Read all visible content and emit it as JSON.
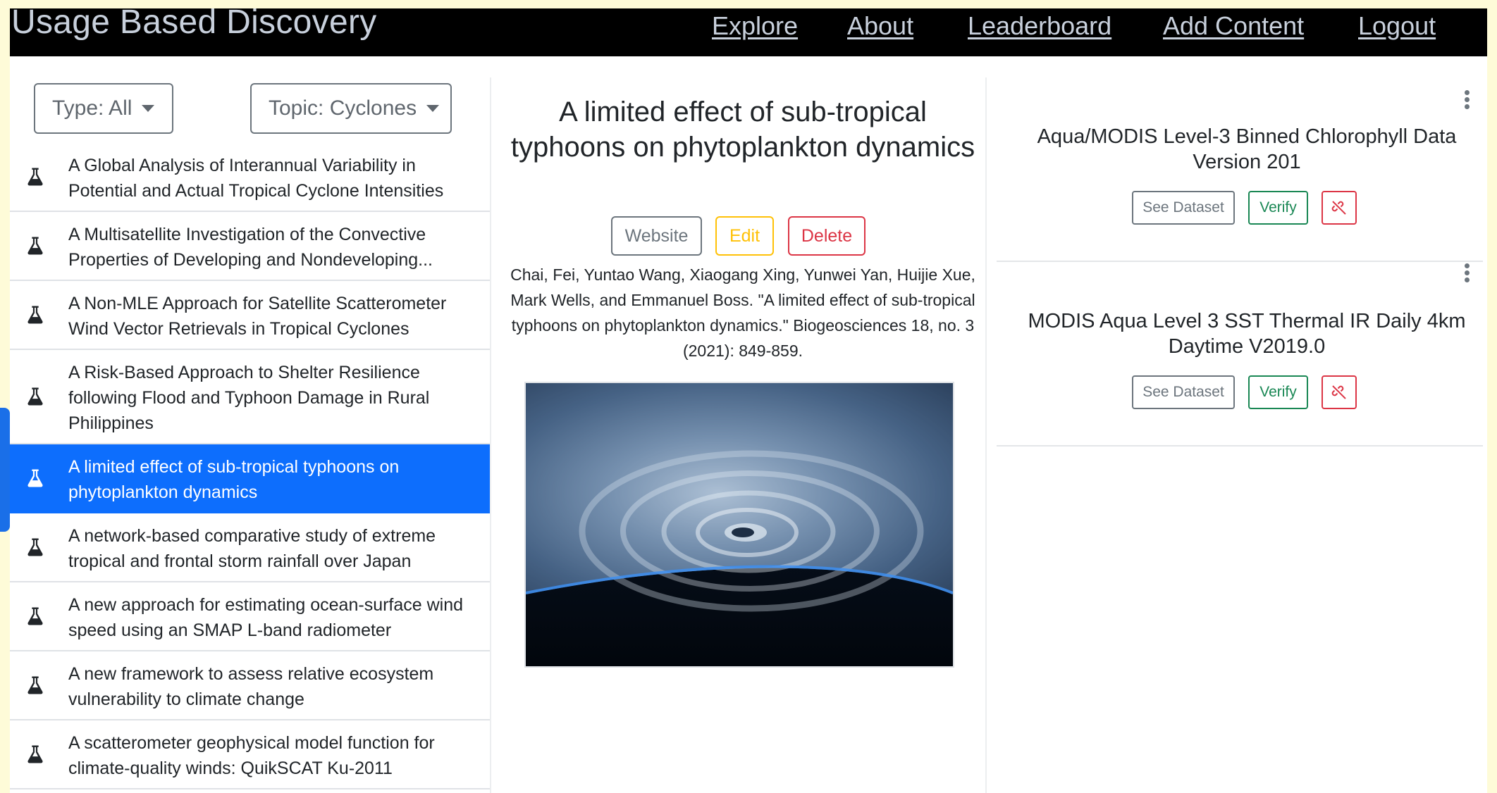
{
  "app": {
    "brand": "Usage Based Discovery"
  },
  "nav": {
    "explore": "Explore",
    "about": "About",
    "leaderboard": "Leaderboard",
    "add_content": "Add Content",
    "logout": "Logout"
  },
  "filters": {
    "type": "Type: All",
    "topic": "Topic: Cyclones"
  },
  "list": {
    "items": [
      {
        "label": "A Global Analysis of Interannual Variability in Potential and Actual Tropical Cyclone Intensities",
        "icon": "flask-icon"
      },
      {
        "label": "A Multisatellite Investigation of the Convective Properties of Developing and Nondeveloping...",
        "icon": "flask-icon"
      },
      {
        "label": "A Non-MLE Approach for Satellite Scatterometer Wind Vector Retrievals in Tropical Cyclones",
        "icon": "flask-icon"
      },
      {
        "label": "A Risk-Based Approach to Shelter Resilience following Flood and Typhoon Damage in Rural Philippines",
        "icon": "flask-icon"
      },
      {
        "label": "A limited effect of sub-tropical typhoons on phytoplankton dynamics",
        "icon": "flask-icon",
        "selected": true
      },
      {
        "label": "A network-based comparative study of extreme tropical and frontal storm rainfall over Japan",
        "icon": "flask-icon"
      },
      {
        "label": "A new approach for estimating ocean-surface wind speed using an SMAP L-band radiometer",
        "icon": "flask-icon"
      },
      {
        "label": "A new framework to assess relative ecosystem vulnerability to climate change",
        "icon": "flask-icon"
      },
      {
        "label": "A scatterometer geophysical model function for climate-quality winds: QuikSCAT Ku-2011",
        "icon": "flask-icon"
      }
    ]
  },
  "detail": {
    "title": "A limited effect of sub-tropical typhoons on phytoplankton dynamics",
    "website_label": "Website",
    "edit_label": "Edit",
    "delete_label": "Delete",
    "citation": "Chai, Fei, Yuntao Wang, Xiaogang Xing, Yunwei Yan, Huijie Xue, Mark Wells, and Emmanuel Boss. \"A limited effect of sub-tropical typhoons on phytoplankton dynamics.\" Biogeosciences 18, no. 3 (2021): 849-859."
  },
  "datasets": [
    {
      "title": "Aqua/MODIS Level-3 Binned Chlorophyll Data Version 201",
      "see_label": "See Dataset",
      "verify_label": "Verify"
    },
    {
      "title": "MODIS Aqua Level 3 SST Thermal IR Daily 4km Daytime V2019.0",
      "see_label": "See Dataset",
      "verify_label": "Verify"
    }
  ],
  "colors": {
    "page_bg": "#fefbd8",
    "navbar": "#000000",
    "primary": "#0d6efd",
    "success": "#198754",
    "warning": "#ffc107",
    "danger": "#dc3545",
    "secondary": "#6c757d"
  }
}
